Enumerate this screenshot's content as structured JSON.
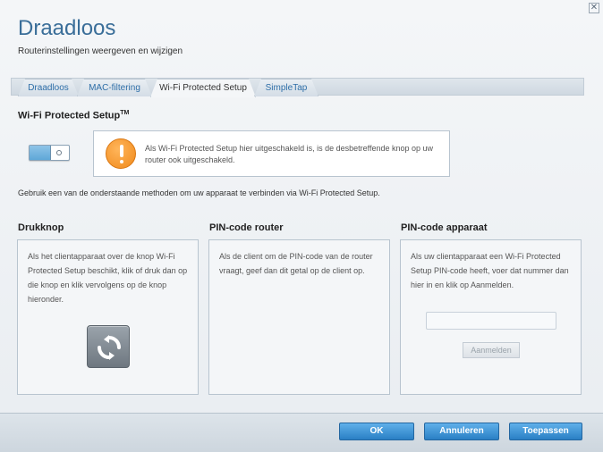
{
  "window": {
    "close_glyph": "✕"
  },
  "header": {
    "title": "Draadloos",
    "subtitle": "Routerinstellingen weergeven en wijzigen"
  },
  "tabs": [
    {
      "label": "Draadloos"
    },
    {
      "label": "MAC-filtering"
    },
    {
      "label": "Wi-Fi Protected Setup",
      "active": true
    },
    {
      "label": "SimpleTap"
    }
  ],
  "section": {
    "title": "Wi-Fi Protected Setup",
    "trademark": "TM"
  },
  "toggle": {
    "state": "off"
  },
  "warning": {
    "icon": "exclamation-icon",
    "text": "Als Wi-Fi Protected Setup hier uitgeschakeld is, is de desbetreffende knop op uw router ook uitgeschakeld."
  },
  "instruction": "Gebruik een van de onderstaande methoden om uw apparaat te verbinden via Wi-Fi Protected Setup.",
  "columns": {
    "push": {
      "title": "Drukknop",
      "text": "Als het clientapparaat over de knop Wi-Fi Protected Setup beschikt, klik of druk dan op die knop en klik vervolgens op de knop hieronder."
    },
    "router_pin": {
      "title": "PIN-code router",
      "text": "Als de client om de PIN-code van de router vraagt, geef dan dit getal op de client op."
    },
    "device_pin": {
      "title": "PIN-code apparaat",
      "text": "Als uw clientapparaat een Wi-Fi Protected Setup PIN-code heeft, voer dat nummer dan hier in en klik op Aanmelden.",
      "input_value": "",
      "button_label": "Aanmelden"
    }
  },
  "footer": {
    "ok": "OK",
    "cancel": "Annuleren",
    "apply": "Toepassen"
  },
  "colors": {
    "accent": "#3a6e99",
    "button_blue": "#2a7fc4",
    "warning_orange": "#f08a1c"
  }
}
